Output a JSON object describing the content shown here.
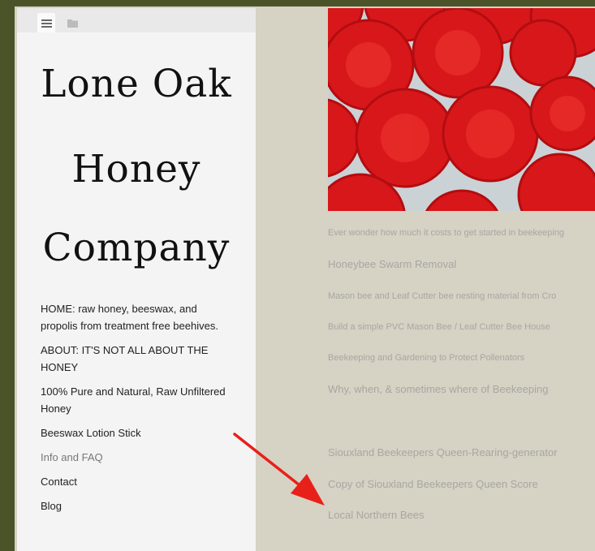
{
  "site": {
    "logo_lines": [
      "Lone Oak",
      "Honey",
      "Company"
    ]
  },
  "topbar": {
    "icons": [
      "menu-icon",
      "folder-icon"
    ]
  },
  "nav": {
    "items": [
      {
        "label": "HOME: raw honey, beeswax, and propolis from treatment free beehives."
      },
      {
        "label": "ABOUT: IT'S NOT ALL ABOUT THE HONEY"
      },
      {
        "label": "100% Pure and Natural, Raw Unfiltered Honey"
      },
      {
        "label": "Beeswax Lotion Stick"
      },
      {
        "label": "Info and FAQ"
      },
      {
        "label": "Contact"
      },
      {
        "label": "Blog"
      }
    ]
  },
  "content": {
    "links": [
      "Ever wonder how much it costs to get started in beekeeping",
      "Honeybee Swarm Removal",
      "Mason bee and Leaf Cutter bee nesting material from Cro",
      "Build a simple PVC Mason Bee / Leaf Cutter Bee House",
      "Beekeeping and Gardening to Protect Pollenators",
      "Why, when, & sometimes where of Beekeeping",
      "Siouxland Beekeepers Queen-Rearing-generator",
      "Copy of Siouxland Beekeepers Queen Score",
      "Local Northern Bees"
    ]
  },
  "colors": {
    "outer_border": "#4b5428",
    "content_bg": "#d6d2c4",
    "sidebar_bg": "#f4f4f4",
    "link_text": "#a7a7a2",
    "arrow": "#e8201a",
    "honeycomb_red": "#d8171b"
  }
}
